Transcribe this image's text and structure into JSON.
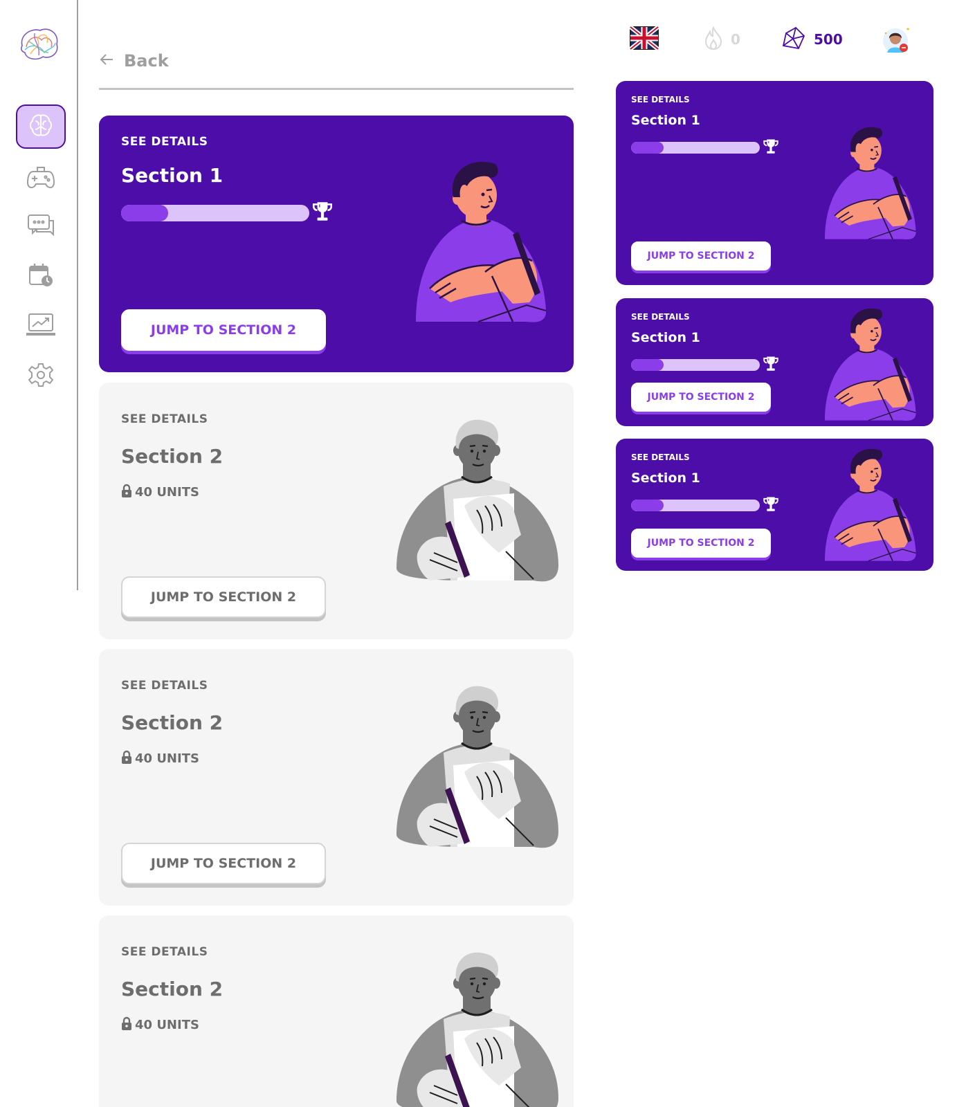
{
  "sidebar": {
    "items": [
      {
        "name": "brain",
        "active": true
      },
      {
        "name": "gamepad",
        "active": false
      },
      {
        "name": "chat",
        "active": false
      },
      {
        "name": "calendar",
        "active": false
      },
      {
        "name": "analytics",
        "active": false
      },
      {
        "name": "settings",
        "active": false
      }
    ]
  },
  "topbar": {
    "language_flag": "uk-flag-icon",
    "streak_count": "0",
    "gem_count": "500"
  },
  "back_label": "Back",
  "main_cards": [
    {
      "state": "active",
      "see_details": "SEE DETAILS",
      "title": "Section 1",
      "progress": 0.25,
      "button": "JUMP TO SECTION 2"
    },
    {
      "state": "locked",
      "see_details": "SEE DETAILS",
      "title": "Section 2",
      "units": "40 UNITS",
      "button": "JUMP TO SECTION 2"
    },
    {
      "state": "locked",
      "see_details": "SEE DETAILS",
      "title": "Section 2",
      "units": "40 UNITS",
      "button": "JUMP TO SECTION 2"
    },
    {
      "state": "locked",
      "see_details": "SEE DETAILS",
      "title": "Section 2",
      "units": "40 UNITS"
    }
  ],
  "side_cards": [
    {
      "see_details": "SEE DETAILS",
      "title": "Section 1",
      "progress": 0.25,
      "button": "JUMP TO SECTION 2"
    },
    {
      "see_details": "SEE DETAILS",
      "title": "Section 1",
      "progress": 0.25,
      "button": "JUMP TO SECTION 2"
    },
    {
      "see_details": "SEE DETAILS",
      "title": "Section 1",
      "progress": 0.25,
      "button": "JUMP TO SECTION 2"
    }
  ],
  "colors": {
    "primary": "#4c0da9",
    "accent": "#8b3dea",
    "light_accent": "#dcc4fa",
    "locked_bg": "#f5f5f5",
    "muted_text": "#6d6d6d"
  }
}
